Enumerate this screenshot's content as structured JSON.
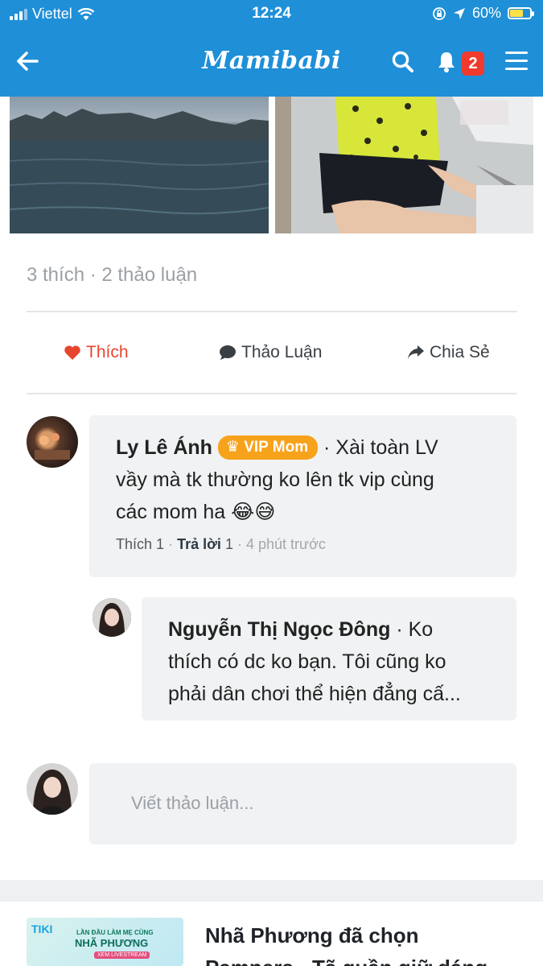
{
  "status_bar": {
    "carrier": "Viettel",
    "time": "12:24",
    "battery": "60%"
  },
  "header": {
    "logo": "Mamibabi",
    "notification_count": "2"
  },
  "post": {
    "stats": "3 thích · 2 thảo luận",
    "actions": {
      "like": "Thích",
      "comment": "Thảo Luận",
      "share": "Chia Sẻ"
    }
  },
  "comments": [
    {
      "author": "Ly Lê Ánh",
      "badge": "VIP Mom",
      "text_line1": " · Xài toàn LV",
      "text_line2": "vầy mà tk thường ko lên tk vip cùng",
      "text_line3": "các mom ha 😂😅",
      "like_label": "Thích",
      "like_count": "1",
      "reply_label": "Trả lời",
      "reply_count": "1",
      "time": "4 phút trước"
    }
  ],
  "reply": {
    "author": "Nguyễn Thị Ngọc Đông",
    "text_line1": " · Ko",
    "text_line2": "thích có dc ko bạn. Tôi cũng ko",
    "text_line3": "phải dân chơi thể hiện đẳng cấ..."
  },
  "write_box": {
    "placeholder": "Viết thảo luận..."
  },
  "ad": {
    "brand": "TIKI",
    "thumb_line1": "LẦN ĐẦU LÀM MẸ CÙNG",
    "thumb_line2": "NHÃ PHƯƠNG",
    "thumb_line3": "XEM LIVESTREAM",
    "title_line1": "Nhã Phương đã chọn",
    "title_line2": "Pampers - Tã quần giữ dáng"
  },
  "colors": {
    "brand_blue": "#1f8fd8",
    "like_red": "#e8452f",
    "vip_orange": "#f7a21b",
    "badge_red": "#f03a2e"
  }
}
